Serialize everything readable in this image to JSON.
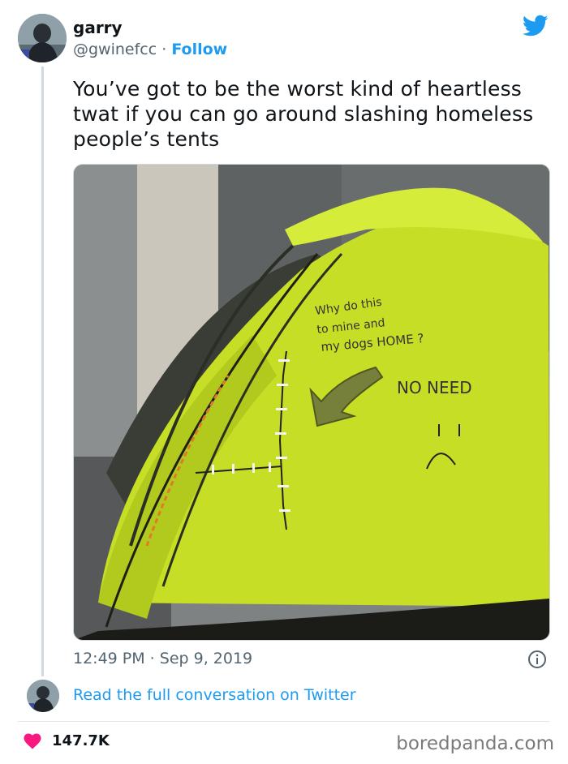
{
  "author": {
    "display_name": "garry",
    "handle": "@gwinefcc",
    "separator": "·",
    "follow_label": "Follow"
  },
  "tweet": {
    "text": "You’ve got to be the worst kind of heartless twat if you can go around slashing homeless people’s tents",
    "timestamp": "12:49 PM · Sep 9, 2019"
  },
  "photo": {
    "tent_writing": {
      "line1": "Why do this",
      "line2": "to mine and",
      "line3": "my dogs HOME ?",
      "no_need": "NO NEED"
    }
  },
  "thread": {
    "read_more_label": "Read the full conversation on Twitter"
  },
  "engagement": {
    "likes": "147.7K"
  },
  "watermark": "boredpanda.com",
  "colors": {
    "twitter_blue": "#1d9bf0",
    "like_red": "#f91880",
    "tent_yellow": "#cde62a"
  },
  "icons": {
    "brand": "twitter-bird-icon",
    "info": "info-icon",
    "like": "heart-icon"
  }
}
